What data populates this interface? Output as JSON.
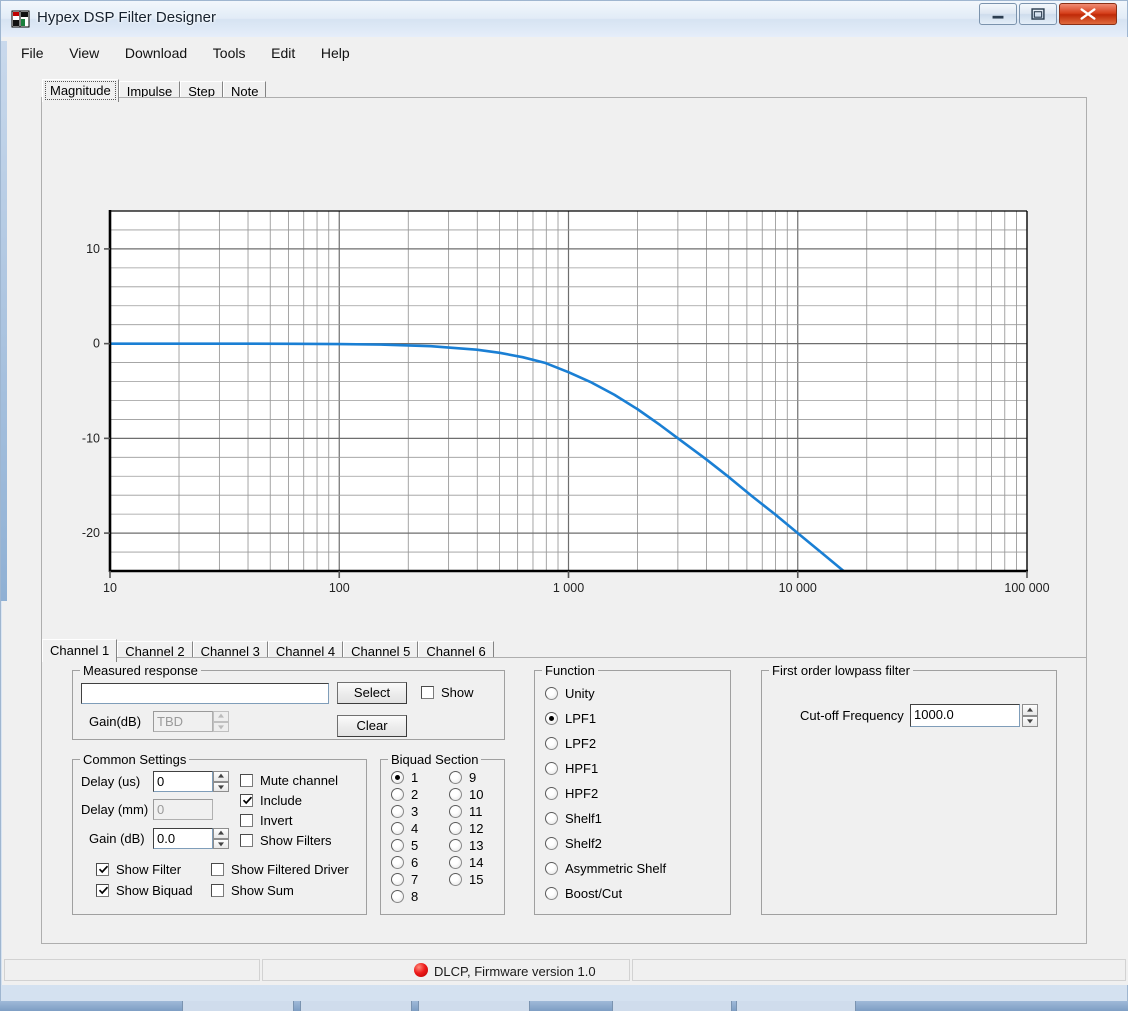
{
  "window": {
    "title": "Hypex DSP Filter Designer",
    "icon": "app-icon",
    "controls": {
      "minimize": "minimize",
      "maximize": "maximize",
      "close": "close"
    }
  },
  "menubar": {
    "items": [
      "File",
      "View",
      "Download",
      "Tools",
      "Edit",
      "Help"
    ]
  },
  "chart_tabs": {
    "items": [
      "Magnitude",
      "Impulse",
      "Step",
      "Note"
    ],
    "selected": "Magnitude"
  },
  "chart_data": {
    "type": "line",
    "title": "",
    "xlabel": "",
    "ylabel": "",
    "xscale": "log",
    "xlim": [
      10,
      100000
    ],
    "ylim": [
      -24,
      14
    ],
    "xticks": [
      10,
      100,
      1000,
      10000,
      100000
    ],
    "xticklabels": [
      "10",
      "100",
      "1 000",
      "10 000",
      "100 000"
    ],
    "yticks": [
      10,
      0,
      -10,
      -20
    ],
    "yticklabels": [
      "10",
      "0",
      "-10",
      "-20"
    ],
    "grid": true,
    "minor_grid": true,
    "legend": "none",
    "line_color": "#1a7fd4",
    "series": [
      {
        "name": "LPF1 1000.0 Hz magnitude",
        "x": [
          10,
          15.8,
          25.1,
          39.8,
          63.1,
          100,
          158,
          251,
          398,
          501,
          631,
          794,
          1000,
          1259,
          1585,
          1995,
          2512,
          3162,
          3981,
          5012,
          6310,
          7943,
          10000,
          12589,
          15849,
          19953,
          25119,
          31623,
          39811,
          50119,
          63096,
          79433,
          100000
        ],
        "y": [
          -0.0004,
          -0.001,
          -0.003,
          -0.007,
          -0.017,
          -0.043,
          -0.108,
          -0.266,
          -0.642,
          -0.97,
          -1.43,
          -2.05,
          -3.01,
          -4.1,
          -5.4,
          -6.9,
          -8.6,
          -10.4,
          -12.2,
          -14.1,
          -16.1,
          -18.0,
          -20.0,
          -22.0,
          -24.0,
          -26.0,
          -28.0,
          -30.0,
          -32.0,
          -34.0,
          -36.0,
          -38.0,
          -40.0
        ],
        "color": "#1a7fd4"
      }
    ]
  },
  "channel_tabs": {
    "items": [
      "Channel 1",
      "Channel 2",
      "Channel 3",
      "Channel 4",
      "Channel 5",
      "Channel 6"
    ],
    "selected": "Channel 1"
  },
  "measured_response": {
    "title": "Measured response",
    "path_value": "",
    "select_label": "Select",
    "clear_label": "Clear",
    "show_label": "Show",
    "show_checked": false,
    "gain_label": "Gain(dB)",
    "gain_value": "TBD",
    "gain_enabled": false
  },
  "common_settings": {
    "title": "Common Settings",
    "delay_us_label": "Delay (us)",
    "delay_us_value": "0",
    "delay_mm_label": "Delay (mm)",
    "delay_mm_value": "0",
    "delay_mm_enabled": false,
    "gain_db_label": "Gain (dB)",
    "gain_db_value": "0.0",
    "checkboxes": [
      {
        "label": "Mute channel",
        "checked": false
      },
      {
        "label": "Include",
        "checked": true
      },
      {
        "label": "Invert",
        "checked": false
      },
      {
        "label": "Show Filters",
        "checked": false
      },
      {
        "label": "Show Filter",
        "checked": true
      },
      {
        "label": "Show Filtered Driver",
        "checked": false
      },
      {
        "label": "Show Biquad",
        "checked": true
      },
      {
        "label": "Show Sum",
        "checked": false
      }
    ]
  },
  "biquad_section": {
    "title": "Biquad Section",
    "left_column": [
      "1",
      "2",
      "3",
      "4",
      "5",
      "6",
      "7",
      "8"
    ],
    "right_column": [
      "9",
      "10",
      "11",
      "12",
      "13",
      "14",
      "15"
    ],
    "selected": "1"
  },
  "function_group": {
    "title": "Function",
    "options": [
      "Unity",
      "LPF1",
      "LPF2",
      "HPF1",
      "HPF2",
      "Shelf1",
      "Shelf2",
      "Asymmetric Shelf",
      "Boost/Cut"
    ],
    "selected": "LPF1"
  },
  "filter_params": {
    "title": "First order lowpass filter",
    "cutoff_label": "Cut-off Frequency",
    "cutoff_value": "1000.0"
  },
  "statusbar": {
    "left_text": "",
    "firmware_text": "DLCP, Firmware version 1.0",
    "led_color": "#ee1b1b",
    "right_text": ""
  }
}
